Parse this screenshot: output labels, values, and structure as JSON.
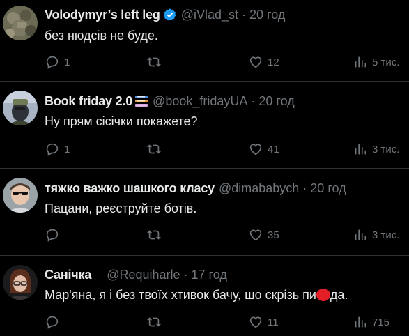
{
  "tweets": [
    {
      "name": "Volodymyr’s left leg",
      "handle": "@iVlad_st",
      "time": "20 год",
      "text": "без нюдсів не буде.",
      "reply_count": "1",
      "like_count": "12",
      "views": "5 тис.",
      "badge": "verified-icon"
    },
    {
      "name": "Book friday 2.0",
      "handle": "@book_fridayUA",
      "time": "20 год",
      "text": "Ну прям сісічки покажете?",
      "reply_count": "1",
      "like_count": "41",
      "views": "3 тис.",
      "badge": "books-emoji-icon"
    },
    {
      "name": "тяжко важко шашкого класу",
      "handle": "@dimababych",
      "time": "20 год",
      "text": "Пацани, реєструйте ботів.",
      "reply_count": "",
      "like_count": "35",
      "views": "3 тис."
    },
    {
      "name": "Санічка",
      "handle": "@Requiharle",
      "time": "17 год",
      "text_before": "Мар'яна, я і без твоїх хтивок бачу, шо скрізь пи",
      "text_after": "да.",
      "reply_count": "",
      "like_count": "11",
      "views": "715"
    }
  ],
  "colors": {
    "background": "#000000",
    "text": "#e7e9ea",
    "muted": "#71767b",
    "divider": "#2f3336",
    "verified": "#1d9bf0",
    "redaction_dot": "#e41e26"
  }
}
